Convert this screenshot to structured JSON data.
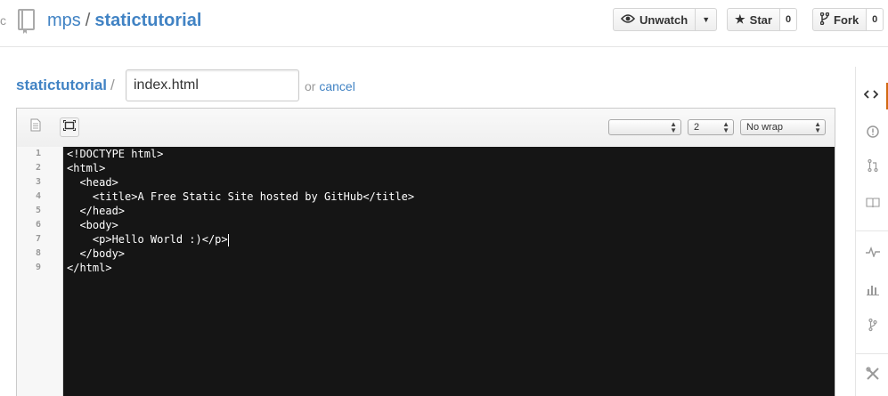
{
  "header": {
    "edge_char": "c",
    "owner": "mps",
    "separator": "/",
    "repo": "statictutorial",
    "watch_label": "Unwatch",
    "star_label": "Star",
    "star_count": "0",
    "fork_label": "Fork",
    "fork_count": "0"
  },
  "editor_bar": {
    "repo_link": "statictutorial",
    "slash": "/",
    "filename_value": "index.html",
    "or_text": "or",
    "cancel_label": "cancel"
  },
  "toolbar": {
    "mode_select": "",
    "indent_select": "2",
    "wrap_select": "No wrap"
  },
  "code": {
    "line_numbers": [
      "1",
      "2",
      "3",
      "4",
      "5",
      "6",
      "7",
      "8",
      "9"
    ],
    "lines": [
      "<!DOCTYPE html>",
      "<html>",
      "  <head>",
      "    <title>A Free Static Site hosted by GitHub</title>",
      "  </head>",
      "  <body>",
      "    <p>Hello World :)</p>",
      "  </body>",
      "</html>"
    ]
  },
  "sidebar": {
    "items": [
      "code-icon",
      "issues-icon",
      "pull-requests-icon",
      "wiki-icon",
      "pulse-icon",
      "graphs-icon",
      "network-icon",
      "settings-icon"
    ]
  },
  "colors": {
    "link": "#4183c4",
    "editor_bg": "#151515",
    "active_tab_accent": "#d26911"
  }
}
